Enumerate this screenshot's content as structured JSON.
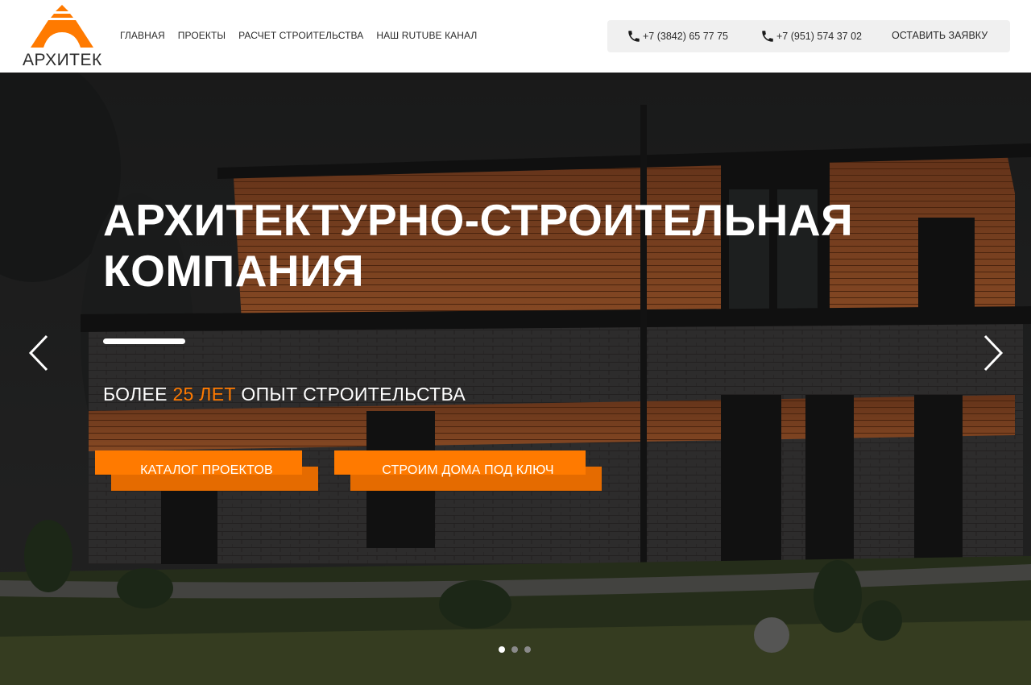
{
  "header": {
    "logo_text": "АРХИТЕК",
    "nav": [
      {
        "label": "ГЛАВНАЯ"
      },
      {
        "label": "ПРОЕКТЫ"
      },
      {
        "label": "РАСЧЕТ СТРОИТЕЛЬСТВА"
      },
      {
        "label": "НАШ RUTUBE КАНАЛ"
      }
    ],
    "phones": [
      {
        "number": "+7 (3842) 65 77 75"
      },
      {
        "number": "+7 (951) 574 37 02"
      }
    ],
    "request_label": "ОСТАВИТЬ ЗАЯВКУ"
  },
  "hero": {
    "title_line1": "АРХИТЕКТУРНО-СТРОИТЕЛЬНАЯ",
    "title_line2": "КОМПАНИЯ",
    "subtitle_before": "БОЛЕЕ ",
    "subtitle_accent": "25 ЛЕТ",
    "subtitle_after": " ОПЫТ СТРОИТЕЛЬСТВА",
    "buttons": [
      {
        "label": "КАТАЛОГ ПРОЕКТОВ"
      },
      {
        "label": "СТРОИМ ДОМА ПОД КЛЮЧ"
      }
    ],
    "slides_total": 3,
    "active_slide": 1
  },
  "colors": {
    "accent": "#ff7a00",
    "accent_dark": "#e56b00",
    "text": "#2b2b2b",
    "header_bg": "#ffffff",
    "contact_bg": "#f0f0f0"
  },
  "icons": {
    "phone": "phone-icon",
    "prev": "chevron-left-icon",
    "next": "chevron-right-icon"
  }
}
